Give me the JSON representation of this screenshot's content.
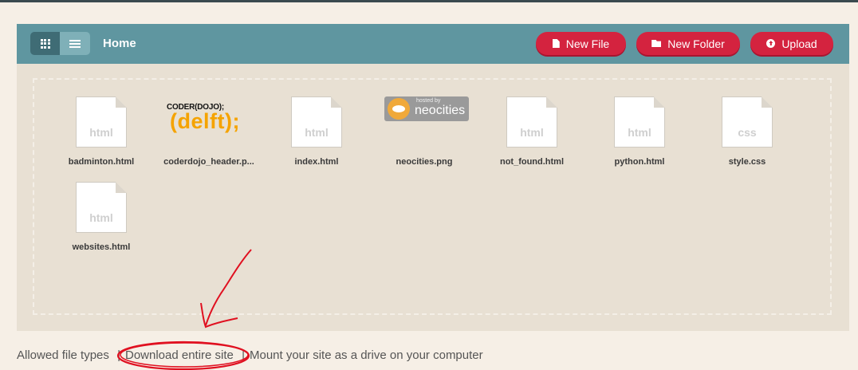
{
  "header": {
    "title": "Home",
    "new_file_label": "New File",
    "new_folder_label": "New Folder",
    "upload_label": "Upload"
  },
  "view_toggle": {
    "active": "grid"
  },
  "files": [
    {
      "name": "badminton.html",
      "type": "html"
    },
    {
      "name": "coderdojo_header.p...",
      "type": "image",
      "thumb_top": "CODER(DOJO);",
      "thumb_bottom": "(delft);"
    },
    {
      "name": "index.html",
      "type": "html"
    },
    {
      "name": "neocities.png",
      "type": "image",
      "thumb_small": "hosted by",
      "thumb_big": "neocities"
    },
    {
      "name": "not_found.html",
      "type": "html"
    },
    {
      "name": "python.html",
      "type": "html"
    },
    {
      "name": "style.css",
      "type": "css"
    },
    {
      "name": "websites.html",
      "type": "html"
    }
  ],
  "footer": {
    "allowed_types": "Allowed file types",
    "download": "Download entire site",
    "mount": "Mount your site as a drive on your computer"
  },
  "colors": {
    "background": "#f6efe6",
    "panel": "#e8e0d3",
    "header": "#5f96a0",
    "button": "#d4233f",
    "annotation": "#e01020"
  }
}
